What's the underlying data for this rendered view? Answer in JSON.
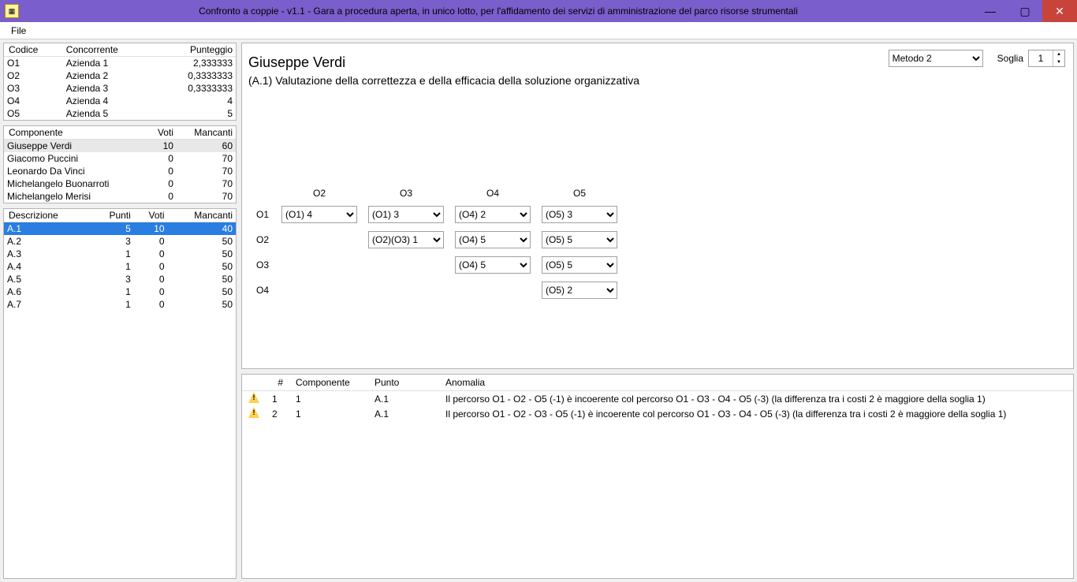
{
  "window": {
    "title": "Confronto a coppie - v1.1 - Gara a procedura aperta, in unico lotto, per l'affidamento dei servizi di amministrazione del parco risorse strumentali"
  },
  "menu": {
    "file": "File"
  },
  "concorrenti": {
    "headers": {
      "codice": "Codice",
      "concorrente": "Concorrente",
      "punteggio": "Punteggio"
    },
    "rows": [
      {
        "codice": "O1",
        "nome": "Azienda 1",
        "punteggio": "2,333333"
      },
      {
        "codice": "O2",
        "nome": "Azienda 2",
        "punteggio": "0,3333333"
      },
      {
        "codice": "O3",
        "nome": "Azienda 3",
        "punteggio": "0,3333333"
      },
      {
        "codice": "O4",
        "nome": "Azienda 4",
        "punteggio": "4"
      },
      {
        "codice": "O5",
        "nome": "Azienda 5",
        "punteggio": "5"
      }
    ]
  },
  "componenti": {
    "headers": {
      "componente": "Componente",
      "voti": "Voti",
      "mancanti": "Mancanti"
    },
    "rows": [
      {
        "nome": "Giuseppe Verdi",
        "voti": "10",
        "mancanti": "60",
        "selected": true
      },
      {
        "nome": "Giacomo Puccini",
        "voti": "0",
        "mancanti": "70"
      },
      {
        "nome": "Leonardo Da Vinci",
        "voti": "0",
        "mancanti": "70"
      },
      {
        "nome": "Michelangelo Buonarroti",
        "voti": "0",
        "mancanti": "70"
      },
      {
        "nome": "Michelangelo Merisi",
        "voti": "0",
        "mancanti": "70"
      }
    ]
  },
  "descrizioni": {
    "headers": {
      "descrizione": "Descrizione",
      "punti": "Punti",
      "voti": "Voti",
      "mancanti": "Mancanti"
    },
    "rows": [
      {
        "d": "A.1",
        "p": "5",
        "v": "10",
        "m": "40",
        "selected": true
      },
      {
        "d": "A.2",
        "p": "3",
        "v": "0",
        "m": "50"
      },
      {
        "d": "A.3",
        "p": "1",
        "v": "0",
        "m": "50"
      },
      {
        "d": "A.4",
        "p": "1",
        "v": "0",
        "m": "50"
      },
      {
        "d": "A.5",
        "p": "3",
        "v": "0",
        "m": "50"
      },
      {
        "d": "A.6",
        "p": "1",
        "v": "0",
        "m": "50"
      },
      {
        "d": "A.7",
        "p": "1",
        "v": "0",
        "m": "50"
      }
    ]
  },
  "main": {
    "method_selected": "Metodo 2",
    "soglia_label": "Soglia",
    "soglia_value": "1",
    "heading": "Giuseppe Verdi",
    "sub": "(A.1) Valutazione della correttezza e della efficacia della soluzione organizzativa",
    "cols": [
      "O2",
      "O3",
      "O4",
      "O5"
    ],
    "rows": [
      "O1",
      "O2",
      "O3",
      "O4"
    ],
    "cells": {
      "O1.O2": "(O1) 4",
      "O1.O3": "(O1) 3",
      "O1.O4": "(O4) 2",
      "O1.O5": "(O5) 3",
      "O2.O3": "(O2)(O3) 1",
      "O2.O4": "(O4) 5",
      "O2.O5": "(O5) 5",
      "O3.O4": "(O4) 5",
      "O3.O5": "(O5) 5",
      "O4.O5": "(O5) 2"
    }
  },
  "anomalie": {
    "headers": {
      "hash": "#",
      "componente": "Componente",
      "punto": "Punto",
      "anomalia": "Anomalia"
    },
    "rows": [
      {
        "n": "1",
        "comp": "1",
        "punto": "A.1",
        "text": "Il percorso O1 - O2 - O5 (-1) è incoerente col percorso O1 - O3 - O4 - O5 (-3) (la differenza tra i costi 2 è maggiore della soglia 1)"
      },
      {
        "n": "2",
        "comp": "1",
        "punto": "A.1",
        "text": "Il percorso O1 - O2 - O3 - O5 (-1) è incoerente col percorso O1 - O3 - O4 - O5 (-3) (la differenza tra i costi 2 è maggiore della soglia 1)"
      }
    ]
  }
}
